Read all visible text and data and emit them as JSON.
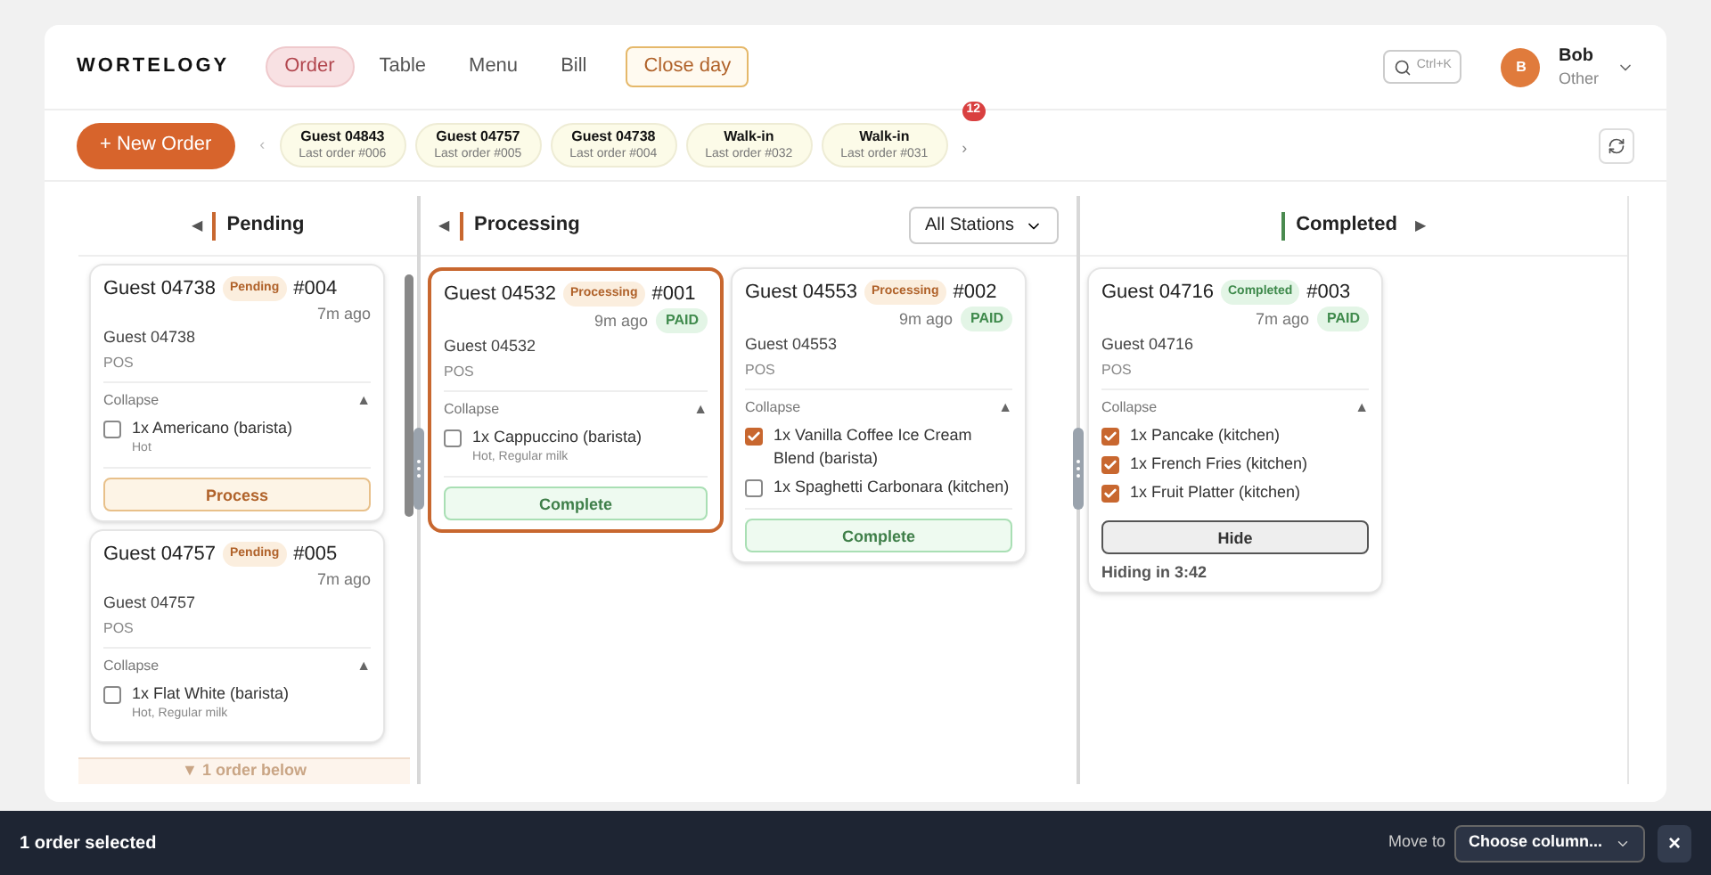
{
  "brand": "WORTELOGY",
  "nav": [
    {
      "label": "Order",
      "selected": true
    },
    {
      "label": "Table",
      "selected": false
    },
    {
      "label": "Menu",
      "selected": false
    },
    {
      "label": "Bill",
      "selected": false
    }
  ],
  "close_day": "Close day",
  "search": {
    "shortcut": "Ctrl+K"
  },
  "user": {
    "initial": "B",
    "name": "Bob",
    "role": "Other"
  },
  "new_order": "+ New Order",
  "recent_prev": "‹",
  "recent_next": "›",
  "recent_badge": "12",
  "recent_guests": [
    {
      "name": "Guest 04843",
      "last_order": "Last order #006"
    },
    {
      "name": "Guest 04757",
      "last_order": "Last order #005"
    },
    {
      "name": "Guest 04738",
      "last_order": "Last order #004"
    },
    {
      "name": "Walk-in",
      "last_order": "Last order #032"
    },
    {
      "name": "Walk-in",
      "last_order": "Last order #031"
    }
  ],
  "columns": [
    {
      "kind": "pending",
      "title": "Pending",
      "color": "#c8672f",
      "arrow": "◀",
      "more_below": "▼ 1 order below",
      "orders": [
        {
          "guest": "Guest 04738",
          "status": "Pending",
          "number": "#004",
          "time": "7m ago",
          "customer": "Guest 04738",
          "source": "POS",
          "collapse": "Collapse",
          "toggle": "▲",
          "selected": false,
          "items": [
            {
              "name": "1x Americano (barista)",
              "note": "Hot",
              "checked": false
            }
          ],
          "action": {
            "kind": "process",
            "label": "Process"
          }
        },
        {
          "guest": "Guest 04757",
          "status": "Pending",
          "number": "#005",
          "time": "7m ago",
          "customer": "Guest 04757",
          "source": "POS",
          "collapse": "Collapse",
          "toggle": "▲",
          "selected": false,
          "items": [
            {
              "name": "1x Flat White (barista)",
              "note": "Hot, Regular milk",
              "checked": false
            }
          ]
        }
      ]
    },
    {
      "kind": "processing",
      "title": "Processing",
      "color": "#c8672f",
      "arrow": "◀",
      "filter": "All Stations",
      "orders": [
        {
          "guest": "Guest 04532",
          "status": "Processing",
          "number": "#001",
          "time": "9m ago",
          "payment": "PAID",
          "customer": "Guest 04532",
          "source": "POS",
          "collapse": "Collapse",
          "toggle": "▲",
          "selected": true,
          "items": [
            {
              "name": "1x Cappuccino (barista)",
              "note": "Hot, Regular milk",
              "checked": false
            }
          ],
          "action": {
            "kind": "complete",
            "label": "Complete"
          }
        },
        {
          "guest": "Guest 04553",
          "status": "Processing",
          "number": "#002",
          "time": "9m ago",
          "payment": "PAID",
          "customer": "Guest 04553",
          "source": "POS",
          "collapse": "Collapse",
          "toggle": "▲",
          "selected": false,
          "items": [
            {
              "name": "1x Vanilla Coffee Ice Cream Blend (barista)",
              "checked": true
            },
            {
              "name": "1x Spaghetti Carbonara (kitchen)",
              "checked": false
            }
          ],
          "action": {
            "kind": "complete",
            "label": "Complete"
          }
        }
      ]
    },
    {
      "kind": "completed",
      "title": "Completed",
      "color": "#4a8a4f",
      "arrow": "▶",
      "orders": [
        {
          "guest": "Guest 04716",
          "status": "Completed",
          "number": "#003",
          "time": "7m ago",
          "payment": "PAID",
          "customer": "Guest 04716",
          "source": "POS",
          "collapse": "Collapse",
          "toggle": "▲",
          "selected": false,
          "items": [
            {
              "name": "1x Pancake (kitchen)",
              "checked": true
            },
            {
              "name": "1x French Fries (kitchen)",
              "checked": true
            },
            {
              "name": "1x Fruit Platter (kitchen)",
              "checked": true
            }
          ],
          "action": {
            "kind": "hide",
            "label": "Hide"
          },
          "hiding": "Hiding in 3:42"
        }
      ]
    }
  ],
  "selection_bar": {
    "text": "1 order selected",
    "move_to": "Move to",
    "choose": "Choose column...",
    "close": "×"
  }
}
